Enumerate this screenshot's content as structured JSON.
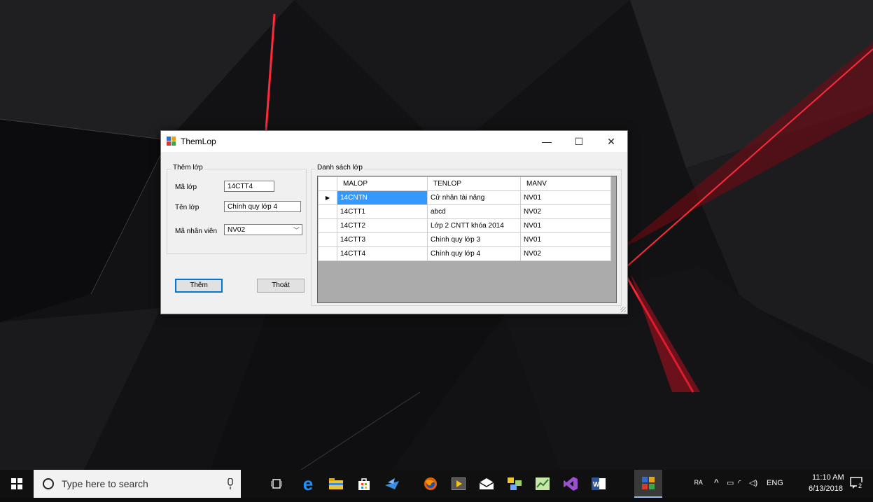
{
  "window": {
    "title": "ThemLop",
    "minimize": "—",
    "maximize": "☐",
    "close": "✕"
  },
  "form": {
    "group_title": "Thêm lớp",
    "malop_label": "Mã lớp",
    "malop_value": "14CTT4",
    "tenlop_label": "Tên lớp",
    "tenlop_value": "Chính quy lớp 4",
    "manv_label": "Mã nhân viên",
    "manv_value": "NV02",
    "add_button": "Thêm",
    "exit_button": "Thoát"
  },
  "list": {
    "group_title": "Danh sách lớp",
    "columns": [
      "MALOP",
      "TENLOP",
      "MANV"
    ],
    "rows": [
      [
        "14CNTN",
        "Cử nhân tài năng",
        "NV01"
      ],
      [
        "14CTT1",
        "abcd",
        "NV02"
      ],
      [
        "14CTT2",
        "Lớp 2 CNTT khóa 2014",
        "NV01"
      ],
      [
        "14CTT3",
        "Chính quy lớp 3",
        "NV01"
      ],
      [
        "14CTT4",
        "Chính quy lớp 4",
        "NV02"
      ]
    ],
    "current_row_marker": "▶"
  },
  "taskbar": {
    "search_placeholder": "Type here to search",
    "language": "ENG",
    "time": "11:10 AM",
    "date": "6/13/2018",
    "notification_count": "2"
  },
  "colors": {
    "selection": "#3399ff",
    "accent": "#0078d7",
    "desktop_red": "#e0102a"
  }
}
